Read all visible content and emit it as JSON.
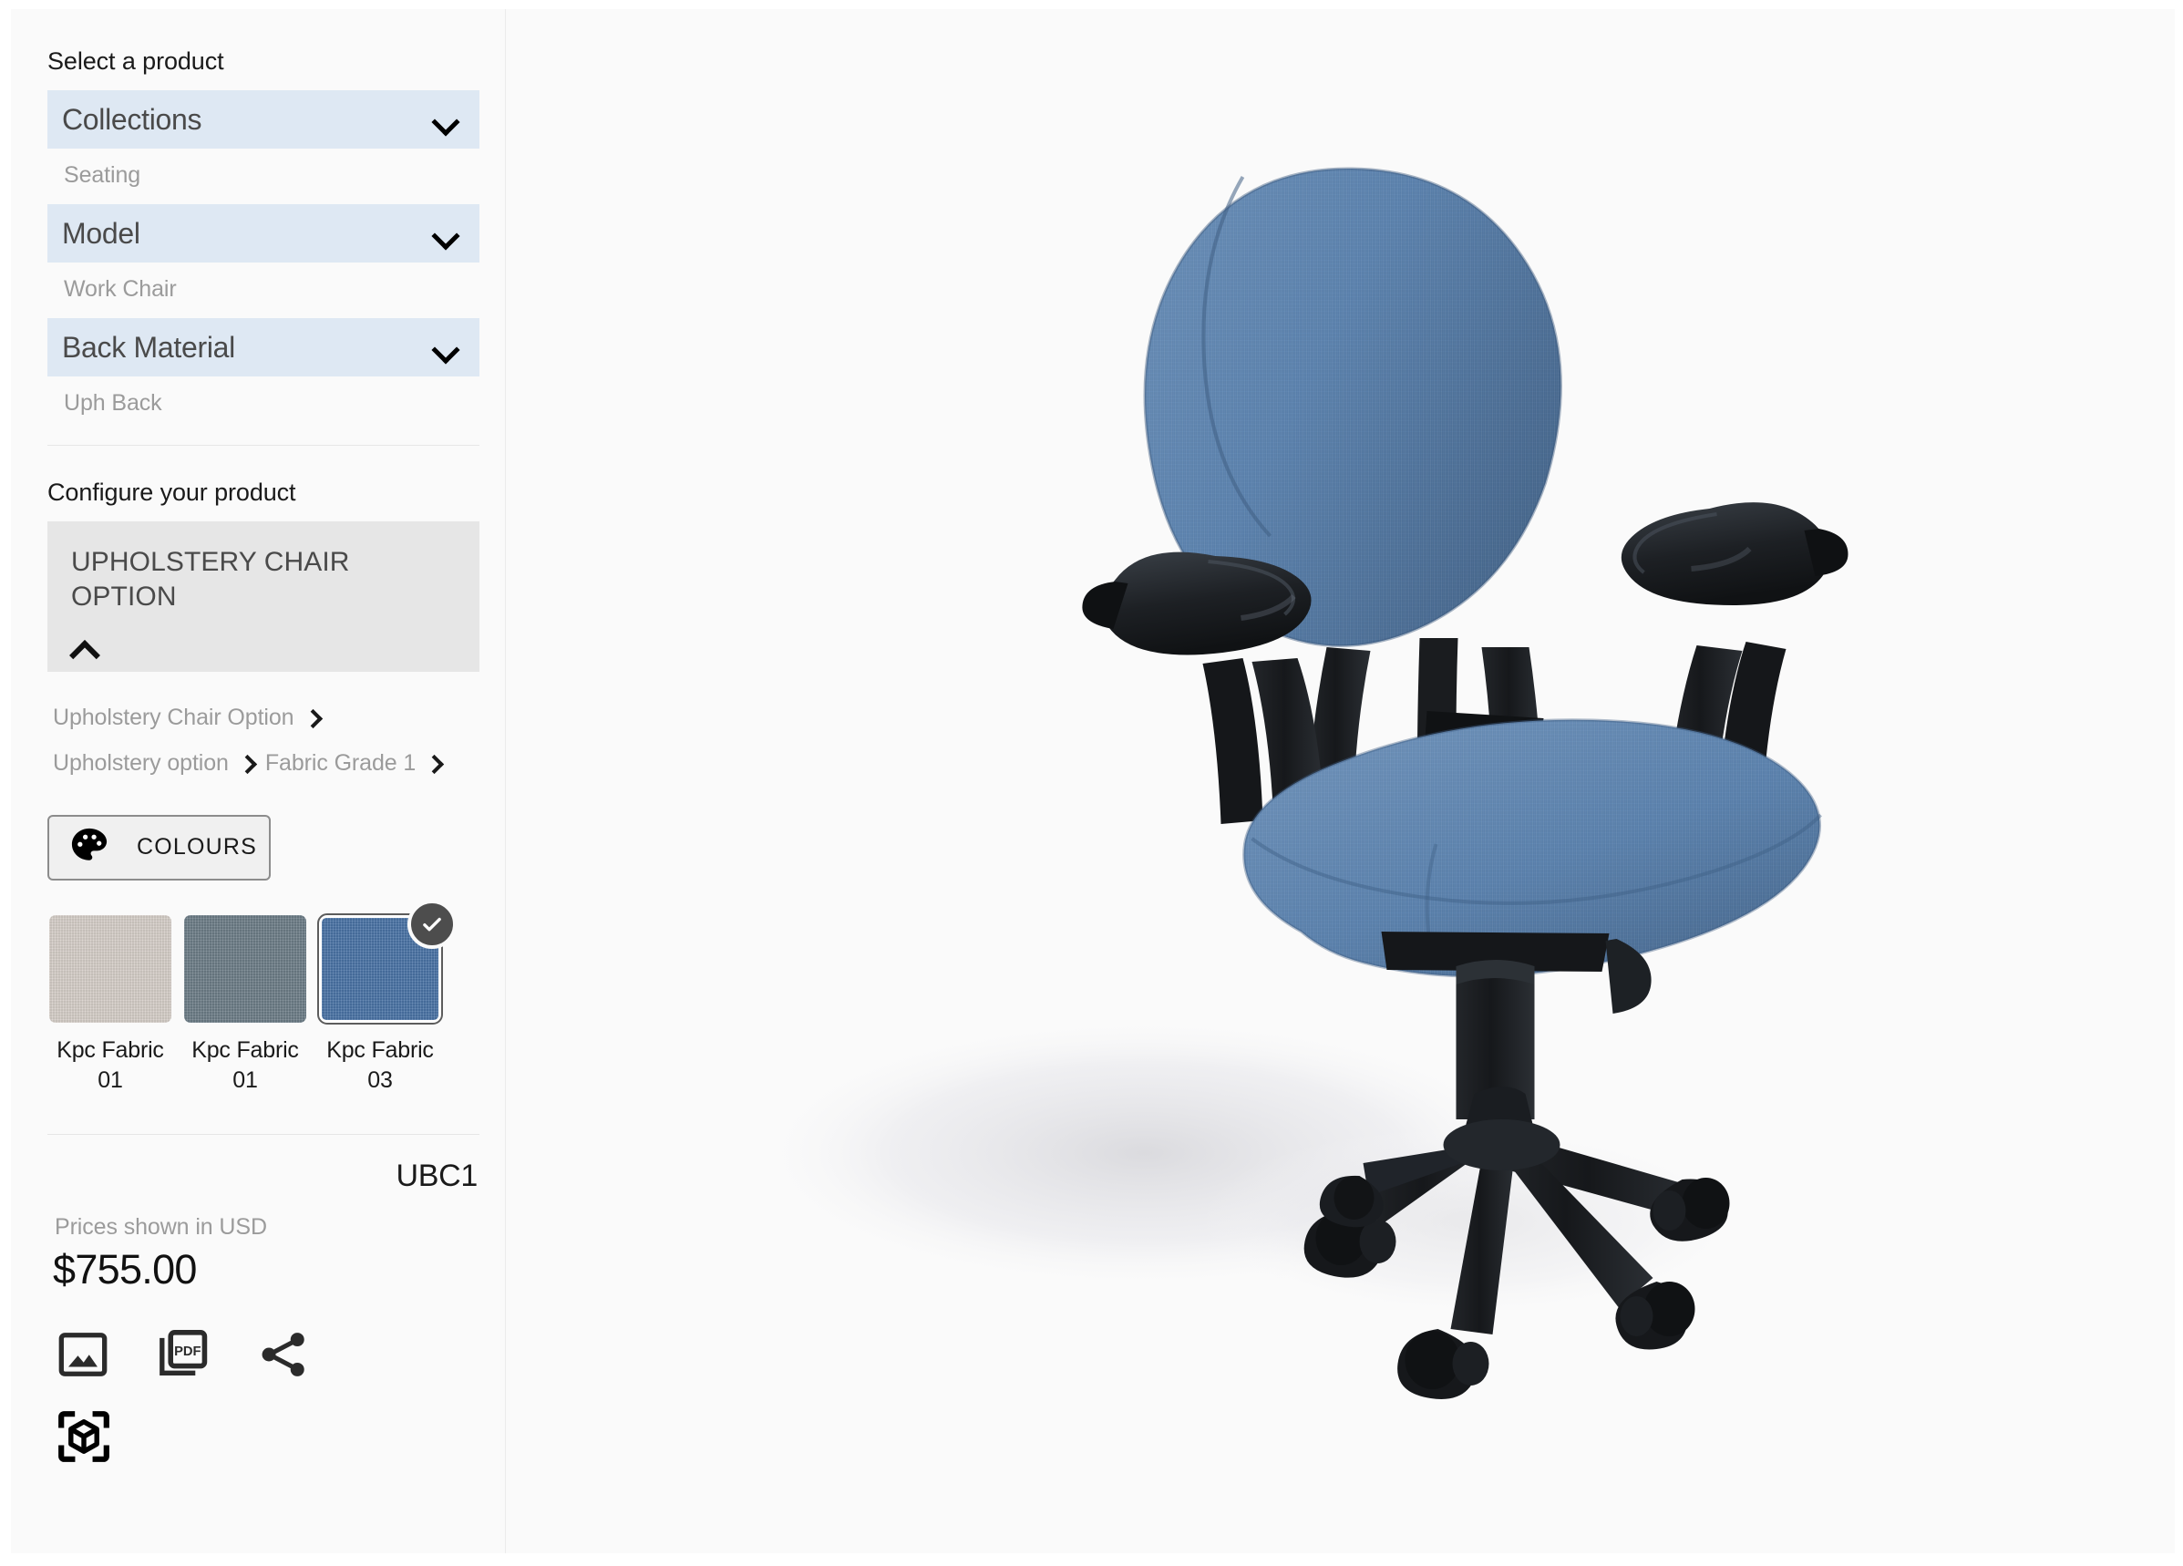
{
  "sidebar": {
    "select_title": "Select a product",
    "selectors": [
      {
        "label": "Collections",
        "value": "Seating",
        "icon": "chevron-down-icon"
      },
      {
        "label": "Model",
        "value": "Work Chair",
        "icon": "chevron-down-icon"
      },
      {
        "label": "Back Material",
        "value": "Uph Back",
        "icon": "chevron-down-icon"
      }
    ],
    "configure_title": "Configure your product",
    "option_card": {
      "title": "UPHOLSTERY CHAIR OPTION",
      "collapse_icon": "chevron-up-icon"
    },
    "breadcrumbs": [
      {
        "parts": [
          "Upholstery Chair Option"
        ]
      },
      {
        "parts": [
          "Upholstery option",
          "Fabric Grade 1"
        ]
      }
    ],
    "colours_button": {
      "label": "COLOURS",
      "icon": "palette-icon"
    },
    "swatches": [
      {
        "name": "Kpc Fabric 01",
        "color": "#d5cec8",
        "selected": false
      },
      {
        "name": "Kpc Fabric 01",
        "color": "#6d7d87",
        "selected": false
      },
      {
        "name": "Kpc Fabric 03",
        "color": "#4a73a5",
        "selected": true
      }
    ],
    "selected_check_icon": "check-circle-icon",
    "sku": "UBC1",
    "price_note": "Prices shown in USD",
    "price": "$755.00",
    "actions": [
      {
        "name": "image-icon",
        "label": "Save image"
      },
      {
        "name": "pdf-icon",
        "label": "Export PDF"
      },
      {
        "name": "share-icon",
        "label": "Share"
      },
      {
        "name": "ar-cube-icon",
        "label": "View in 3D"
      }
    ]
  },
  "viewer": {
    "product_alt": "Upholstered work chair, blue fabric, black frame",
    "fabric_color": "#5a81ad",
    "fabric_shadow": "#3f5f84",
    "frame_color": "#1b1d20",
    "background": "#fafafa"
  },
  "theme": {
    "accent_select_bg": "#dee8f3",
    "card_bg": "#e6e6e6",
    "muted_text": "#9b9b9b",
    "text": "#1a1a1a"
  }
}
